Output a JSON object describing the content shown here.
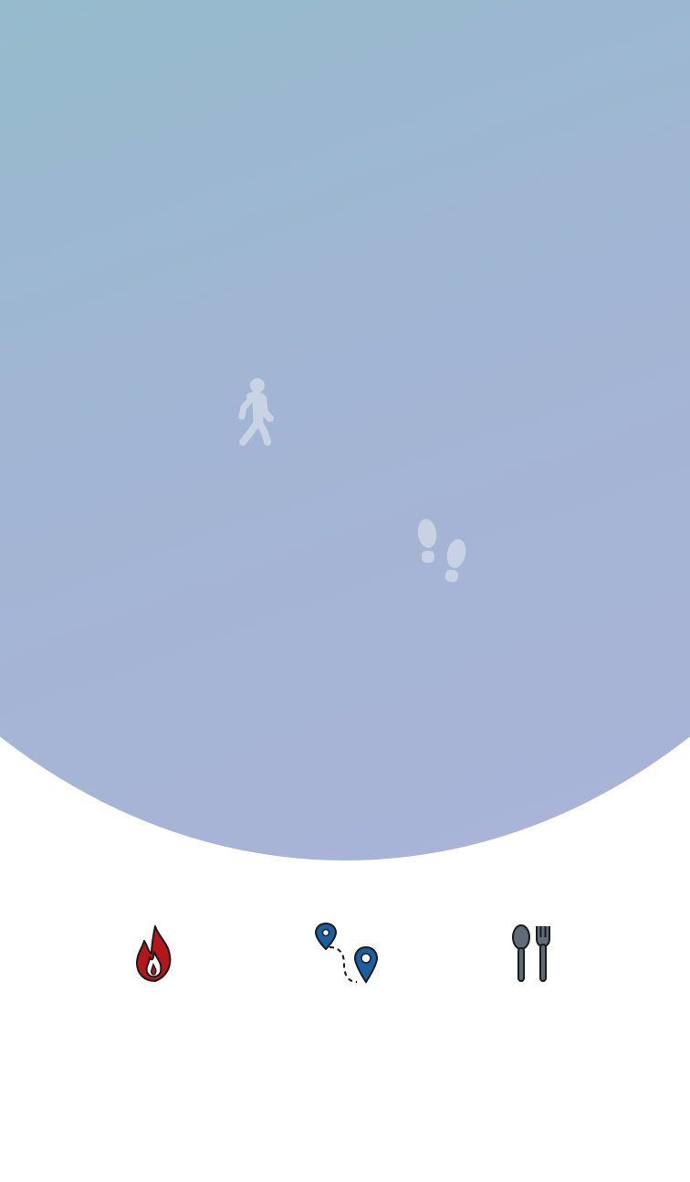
{
  "hero": {
    "icons": [
      "walking-person-icon",
      "footprints-icon"
    ],
    "gradient_colors": [
      "#8ec6c9",
      "#93bccb",
      "#a3b5d4",
      "#abb3d8"
    ]
  },
  "stats": [
    {
      "icon": "fire-icon",
      "color": "#b3161b"
    },
    {
      "icon": "route-pins-icon",
      "color": "#1b5fa3"
    },
    {
      "icon": "spoon-fork-icon",
      "color": "#5f6b75"
    }
  ]
}
